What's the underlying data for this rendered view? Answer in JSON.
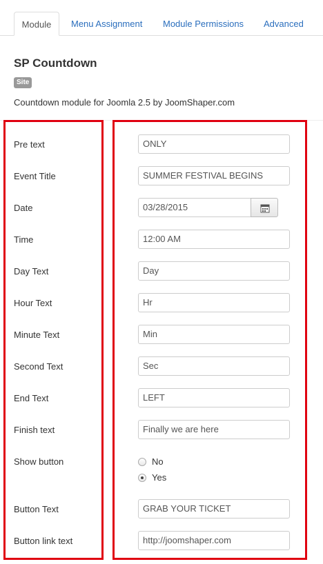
{
  "tabs": [
    {
      "label": "Module"
    },
    {
      "label": "Menu Assignment"
    },
    {
      "label": "Module Permissions"
    },
    {
      "label": "Advanced"
    }
  ],
  "module": {
    "title": "SP Countdown",
    "badge": "Site",
    "description": "Countdown module for Joomla 2.5 by JoomShaper.com"
  },
  "form": {
    "pre_text": {
      "label": "Pre text",
      "value": "ONLY"
    },
    "event_title": {
      "label": "Event Title",
      "value": "SUMMER FESTIVAL BEGINS"
    },
    "date": {
      "label": "Date",
      "value": "03/28/2015",
      "button_icon": "calendar-icon"
    },
    "time": {
      "label": "Time",
      "value": "12:00 AM"
    },
    "day_text": {
      "label": "Day Text",
      "value": "Day"
    },
    "hour_text": {
      "label": "Hour Text",
      "value": "Hr"
    },
    "minute_text": {
      "label": "Minute Text",
      "value": "Min"
    },
    "second_text": {
      "label": "Second Text",
      "value": "Sec"
    },
    "end_text": {
      "label": "End Text",
      "value": "LEFT"
    },
    "finish_text": {
      "label": "Finish text",
      "value": "Finally we are here"
    },
    "show_button": {
      "label": "Show button",
      "options": [
        {
          "label": "No",
          "checked": false
        },
        {
          "label": "Yes",
          "checked": true
        }
      ]
    },
    "button_text": {
      "label": "Button Text",
      "value": "GRAB YOUR TICKET"
    },
    "button_link_text": {
      "label": "Button link text",
      "value": "http://joomshaper.com"
    }
  },
  "colors": {
    "highlight_border": "#e00010",
    "link": "#2a6ebd"
  }
}
